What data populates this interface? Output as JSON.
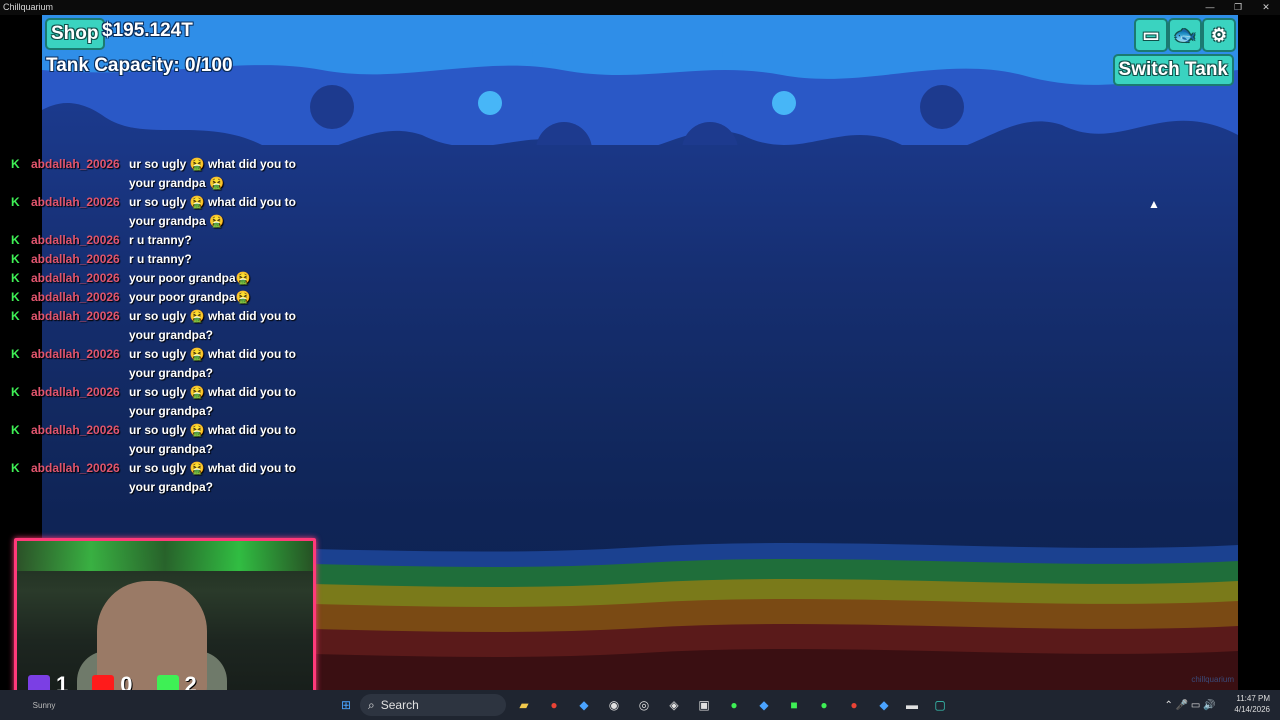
{
  "window": {
    "title": "Chillquarium",
    "min": "—",
    "max": "❐",
    "close": "✕"
  },
  "hud": {
    "shop_label": "Shop",
    "money": "$195.124T",
    "capacity": "Tank Capacity: 0/100",
    "switch_tank": "Switch Tank",
    "icons": [
      "screen-icon",
      "fish-icon",
      "gear-icon"
    ]
  },
  "chat": [
    {
      "user": "abdallah_20026",
      "text": "ur so ugly 🤮 what did you to your grandpa 🤮"
    },
    {
      "user": "abdallah_20026",
      "text": "ur so ugly 🤮 what did you to your grandpa 🤮"
    },
    {
      "user": "abdallah_20026",
      "text": "r u tranny?"
    },
    {
      "user": "abdallah_20026",
      "text": "r u tranny?"
    },
    {
      "user": "abdallah_20026",
      "text": "your poor grandpa🤮"
    },
    {
      "user": "abdallah_20026",
      "text": "your poor grandpa🤮"
    },
    {
      "user": "abdallah_20026",
      "text": "ur so ugly 🤮 what did you to your grandpa?"
    },
    {
      "user": "abdallah_20026",
      "text": "ur so ugly 🤮 what did you to your grandpa?"
    },
    {
      "user": "abdallah_20026",
      "text": "ur so ugly 🤮 what did you to your grandpa?"
    },
    {
      "user": "abdallah_20026",
      "text": "ur so ugly 🤮 what did you to your grandpa?"
    },
    {
      "user": "abdallah_20026",
      "text": "ur so ugly 🤮 what did you to your grandpa?"
    }
  ],
  "viewers": {
    "twitch": "1",
    "youtube": "0",
    "kick": "2"
  },
  "taskbar": {
    "search_placeholder": "Search",
    "time": "11:47 PM",
    "date": "4/14/2026",
    "weather": "Sunny"
  },
  "colors": {
    "accent": "#3ad3c0",
    "chat_user": "#e2556e",
    "kick_green": "#3ef055"
  }
}
